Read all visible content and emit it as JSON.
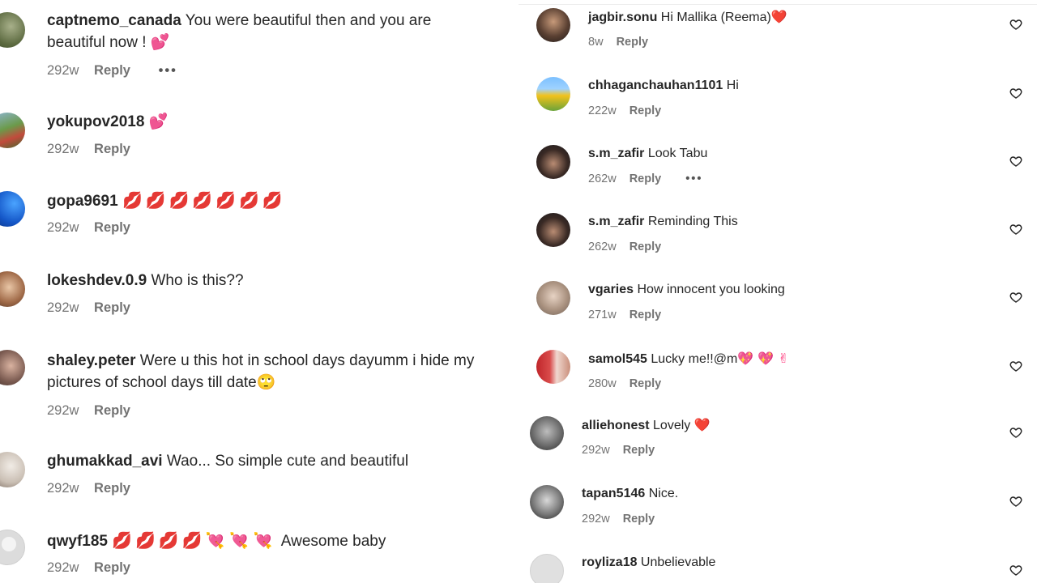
{
  "left_comments": [
    {
      "username": "captnemo_canada",
      "text": "You were beautiful then and you are",
      "text2": "beautiful now ! ",
      "emoji": "💕",
      "time": "292w",
      "reply": "Reply",
      "more": "•••"
    },
    {
      "username": "yokupov2018",
      "text": " ",
      "emoji": "💕",
      "time": "292w",
      "reply": "Reply"
    },
    {
      "username": "gopa9691",
      "text": " ",
      "emoji": "💋💋💋💋💋💋💋",
      "time": "292w",
      "reply": "Reply"
    },
    {
      "username": "lokeshdev.0.9",
      "text": " Who is this??",
      "time": "292w",
      "reply": "Reply"
    },
    {
      "username": "shaley.peter",
      "text": " Were u this hot in school days dayumm i hide my",
      "text2": "pictures of school days till date",
      "emoji": "🙄",
      "time": "292w",
      "reply": "Reply"
    },
    {
      "username": "ghumakkad_avi",
      "text": " Wao... So simple cute and beautiful",
      "time": "292w",
      "reply": "Reply"
    },
    {
      "username": "qwyf185",
      "text_prefix": " ",
      "emoji": "💋💋💋💋",
      "emoji2": "💘💘💘",
      "text": " Awesome baby",
      "time": "292w",
      "reply": "Reply"
    }
  ],
  "right_comments": [
    {
      "username": "jagbir.sonu",
      "text": " Hi Mallika (Reema)",
      "emoji": "❤️",
      "time": "8w",
      "reply": "Reply"
    },
    {
      "username": "chhaganchauhan1101",
      "text": " Hi",
      "time": "222w",
      "reply": "Reply"
    },
    {
      "username": "s.m_zafir",
      "text": " Look Tabu",
      "time": "262w",
      "reply": "Reply",
      "more": "•••"
    },
    {
      "username": "s.m_zafir",
      "text": " Reminding This",
      "time": "262w",
      "reply": "Reply"
    },
    {
      "username": "vgaries",
      "text": " How innocent you looking",
      "time": "271w",
      "reply": "Reply"
    },
    {
      "username": "samol545",
      "text": " Lucky me!!@m",
      "emoji": "💖 💖 ✌",
      "time": "280w",
      "reply": "Reply"
    },
    {
      "username": "alliehonest",
      "text": " Lovely ",
      "emoji": "❤️",
      "time": "292w",
      "reply": "Reply"
    },
    {
      "username": "tapan5146",
      "text": " Nice.",
      "time": "292w",
      "reply": "Reply"
    },
    {
      "username": "royliza18",
      "text": " Unbelievable",
      "time": "",
      "reply": ""
    }
  ],
  "colors": {
    "username": "#262626",
    "meta": "#737373",
    "heart_outline": "#262626",
    "emoji_red": "#e0173f",
    "emoji_pink": "#ff2d74"
  },
  "icons": {
    "like": "heart-outline-icon",
    "more": "more-horizontal-icon"
  }
}
